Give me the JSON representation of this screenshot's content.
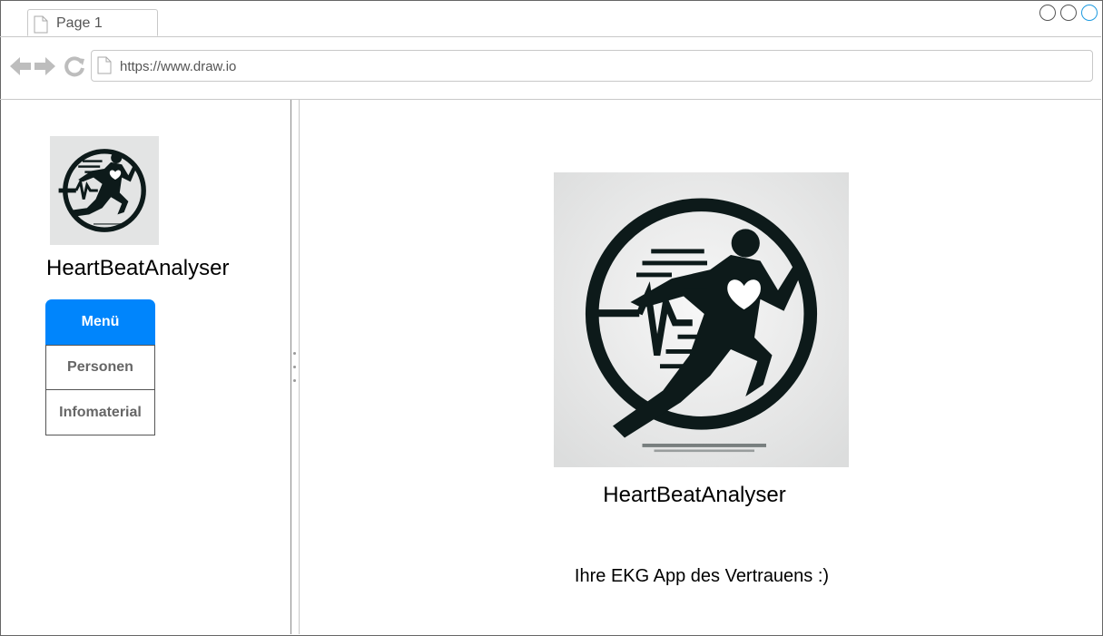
{
  "browser": {
    "tab_label": "Page 1",
    "url": "https://www.draw.io"
  },
  "sidebar": {
    "app_name": "HeartBeatAnalyser",
    "menu": {
      "header": "Menü",
      "items": [
        {
          "label": "Personen"
        },
        {
          "label": "Infomaterial"
        }
      ]
    }
  },
  "main": {
    "title": "HeartBeatAnalyser",
    "subtitle": "Ihre EKG App des Vertrauens :)"
  },
  "colors": {
    "accent": "#0085fc",
    "logo_ink": "#0d1a1a",
    "logo_bg": "#e3e4e4"
  }
}
